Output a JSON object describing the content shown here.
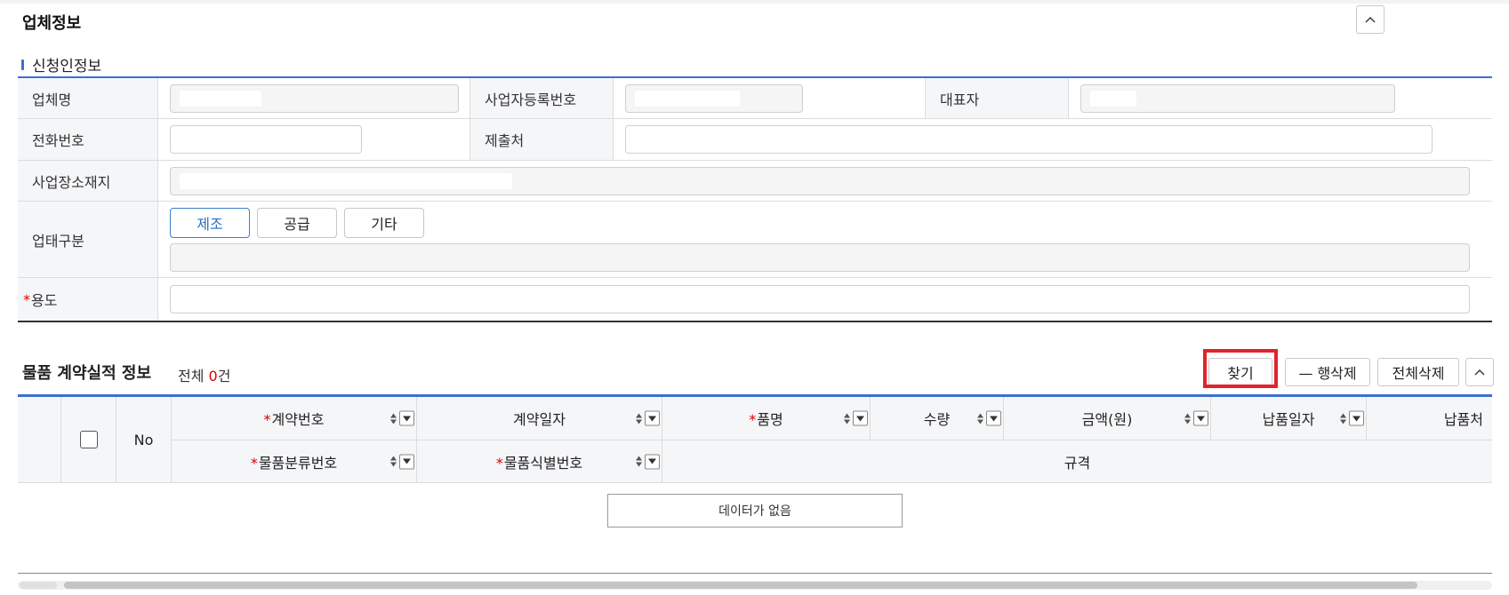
{
  "company": {
    "title": "업체정보",
    "applicant_title": "신청인정보",
    "labels": {
      "company_name": "업체명",
      "business_reg_no": "사업자등록번호",
      "representative": "대표자",
      "phone": "전화번호",
      "submit_to": "제출처",
      "address": "사업장소재지",
      "business_type": "업태구분",
      "purpose": "용도"
    },
    "business_type_options": [
      "제조",
      "공급",
      "기타"
    ],
    "selected_business_type": "제조"
  },
  "contract": {
    "title": "물품 계약실적 정보",
    "total_prefix": "전체 ",
    "total_count": "0",
    "total_suffix": "건",
    "buttons": {
      "find": "찾기",
      "delete_row": "— 행삭제",
      "delete_all": "전체삭제"
    },
    "columns_row1": {
      "no": "No",
      "contract_no": "계약번호",
      "contract_date": "계약일자",
      "item_name": "품명",
      "quantity": "수량",
      "amount": "금액(원)",
      "delivery_date": "납품일자",
      "delivery_place": "납품처"
    },
    "columns_row2": {
      "classification_no": "물품분류번호",
      "identification_no": "물품식별번호",
      "spec": "규격"
    },
    "required_mark": "*",
    "empty_message": "데이터가 없음"
  }
}
